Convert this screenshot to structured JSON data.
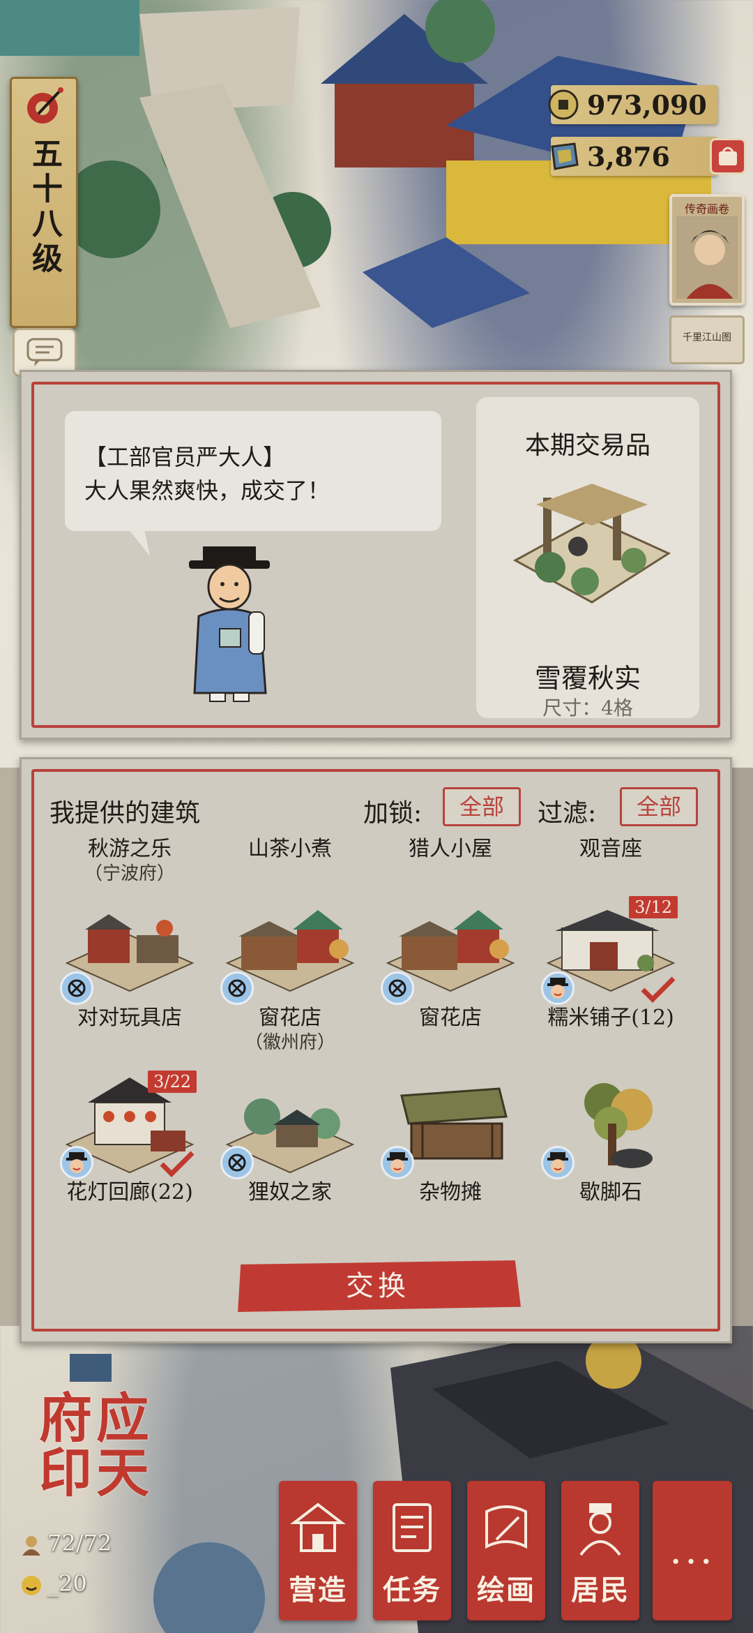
{
  "player": {
    "level_label": "五十八级"
  },
  "currency": {
    "coins": "973,090",
    "gems": "3,876"
  },
  "side": {
    "event_card_title": "传奇画卷",
    "notice_card_text": "千里江山图"
  },
  "dialog": {
    "speaker": "【工部官员严大人】",
    "line": "大人果然爽快，成交了！"
  },
  "trade_item": {
    "section_title": "本期交易品",
    "name": "雪覆秋实",
    "size": "尺寸：4格"
  },
  "offer": {
    "title": "我提供的建筑",
    "lock_label": "加锁:",
    "lock_value": "全部",
    "filter_label": "过滤:",
    "filter_value": "全部",
    "header_items": [
      {
        "name": "秋游之乐",
        "sub": "（宁波府）"
      },
      {
        "name": "山茶小煮",
        "sub": ""
      },
      {
        "name": "猎人小屋",
        "sub": ""
      },
      {
        "name": "观音座",
        "sub": ""
      }
    ],
    "row1": [
      {
        "name": "对对玩具店",
        "sub": "",
        "badge": "locked",
        "count": "",
        "checked": false
      },
      {
        "name": "窗花店",
        "sub": "（徽州府）",
        "badge": "locked",
        "count": "",
        "checked": false
      },
      {
        "name": "窗花店",
        "sub": "",
        "badge": "locked",
        "count": "",
        "checked": false
      },
      {
        "name": "糯米铺子(12)",
        "sub": "",
        "badge": "resident",
        "count": "3/12",
        "checked": true
      }
    ],
    "row2": [
      {
        "name": "花灯回廊(22)",
        "sub": "",
        "badge": "resident",
        "count": "3/22",
        "checked": true
      },
      {
        "name": "狸奴之家",
        "sub": "",
        "badge": "locked",
        "count": "",
        "checked": false
      },
      {
        "name": "杂物摊",
        "sub": "",
        "badge": "resident",
        "count": "",
        "checked": false
      },
      {
        "name": "歇脚石",
        "sub": "",
        "badge": "resident",
        "count": "",
        "checked": false
      }
    ],
    "exchange_button": "交换"
  },
  "city": {
    "seal": "应天府印",
    "population": "72/72",
    "stat2": "_20"
  },
  "menu": {
    "items": [
      "营造",
      "任务",
      "绘画",
      "居民"
    ],
    "more": "..."
  },
  "colors": {
    "accent_red": "#b8423c",
    "gold": "#d9c286",
    "panel_bg": "#cfcbc0"
  }
}
